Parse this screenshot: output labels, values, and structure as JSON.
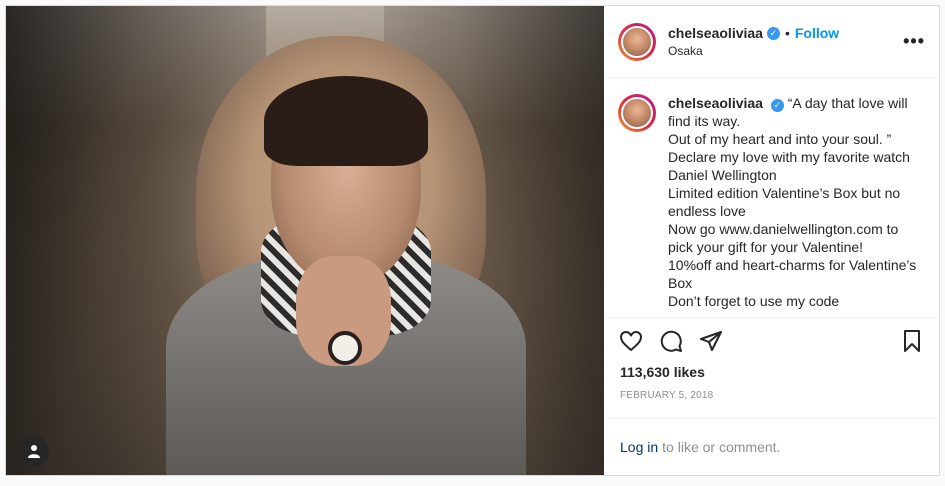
{
  "post": {
    "username": "chelseaoliviaa",
    "verified_icon": "verified-badge-icon",
    "dot": "•",
    "follow_label": "Follow",
    "location": "Osaka",
    "more_icon": "more-options-icon",
    "more_label": "•••"
  },
  "caption": {
    "username": "chelseaoliviaa",
    "lines": [
      "“A day that love will find its way.",
      "Out of my heart and into your soul. ”",
      "Declare my love with my favorite watch Daniel Wellington",
      "Limited edition Valentine’s Box but no endless love",
      "Now go www.danielwellington.com to pick your gift for your Valentine!",
      "10%off and heart-charms for Valentine’s Box",
      "Don’t forget to use my code"
    ]
  },
  "actions": {
    "like_icon": "heart-icon",
    "comment_icon": "comment-icon",
    "share_icon": "share-icon",
    "save_icon": "bookmark-icon"
  },
  "likes_text": "113,630 likes",
  "date_text": "FEBRUARY 5, 2018",
  "login": {
    "link_label": "Log in",
    "rest_text": "to like or comment."
  },
  "media": {
    "tag_icon": "user-tag-icon"
  }
}
